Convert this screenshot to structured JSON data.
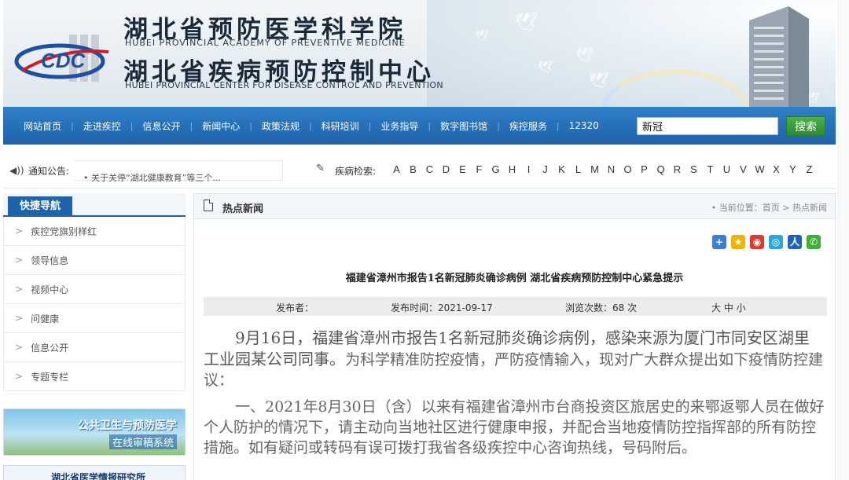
{
  "header": {
    "cn_title_1": "湖北省预防医学科学院",
    "en_title_1": "HUBEI PROVINCIAL ACADEMY OF PREVENTIVE MEDICINE",
    "cn_title_2": "湖北省疾病预防控制中心",
    "en_title_2": "HUBEI PROVINCIAL CENTER FOR DISEASE CONTROL AND PREVENTION",
    "logo_text": "CDC"
  },
  "nav": {
    "items": [
      "网站首页",
      "走进疾控",
      "信息公开",
      "新闻中心",
      "政策法规",
      "科研培训",
      "业务指导",
      "数字图书馆",
      "疾控服务",
      "12320"
    ],
    "search_value": "新冠",
    "search_button": "搜索"
  },
  "notice": {
    "label": "通知公告:",
    "announcement": "• 关于关停“湖北健康教育”等三个...",
    "disease_label": "疾病检索:",
    "letters": [
      "A",
      "B",
      "C",
      "D",
      "E",
      "F",
      "G",
      "H",
      "I",
      "J",
      "K",
      "L",
      "M",
      "N",
      "O",
      "P",
      "Q",
      "R",
      "S",
      "T",
      "U",
      "V",
      "W",
      "X",
      "Y",
      "Z"
    ]
  },
  "sidebar": {
    "title": "快捷导航",
    "items": [
      "疾控党旗别样红",
      "领导信息",
      "视频中心",
      "问健康",
      "信息公开",
      "专题专栏"
    ],
    "promo1_line1": "公共卫生与预防医学",
    "promo1_line2": "在线审稿系统",
    "promo2_text": "湖北省医学情报研究所"
  },
  "main": {
    "section_title": "热点新闻",
    "breadcrumb": "• 当前位置：首页 > 热点新闻",
    "article_title": "福建省漳州市报告1名新冠肺炎确诊病例 湖北省疾病预防控制中心紧急提示",
    "meta": {
      "publisher": "发布者：",
      "publish_time": "发布时间：2021-09-17",
      "views": "浏览次数：68 次",
      "font_size": "大 中 小"
    },
    "para1_emphasis": "9月16日，福建省漳州市报告1名新冠肺炎确诊病例，感染来源为厦门市同安区湖里工业园某公司同事。",
    "para1_rest": "为科学精准防控疫情，严防疫情输入，现对广大群众提出如下疫情防控建议：",
    "para2": "一、2021年8月30日（含）以来有福建省漳州市台商投资区旅居史的来鄂返鄂人员在做好个人防护的情况下，请主动向当地社区进行健康申报，并配合当地疫情防控指挥部的所有防控措施。如有疑问或转码有误可拨打我省各级疾控中心咨询热线，号码附后。"
  },
  "colors": {
    "nav_blue": "#1f63aa",
    "search_green": "#2e8b2e"
  }
}
